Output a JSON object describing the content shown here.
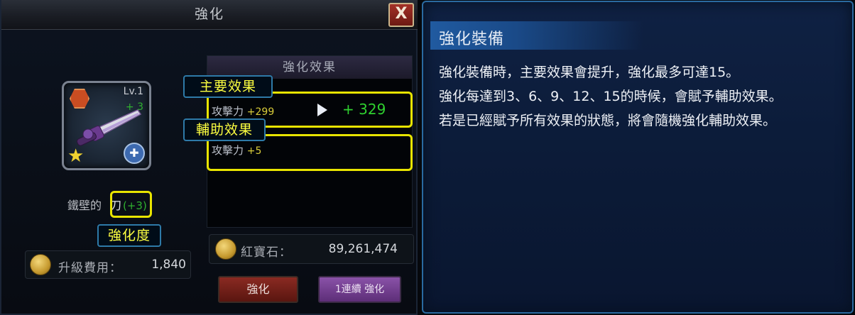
{
  "window": {
    "title": "強化",
    "close_label": "X"
  },
  "item": {
    "level": "Lv.1",
    "plus": "+ 3",
    "name": "鐵壁的",
    "name_suffix": "刀",
    "enhance_badge": "(+3)"
  },
  "tags": {
    "enhance_level": "強化度",
    "main_effect": "主要效果",
    "sub_effect": "輔助效果"
  },
  "cost": {
    "label": "升級費用：",
    "value": "1,840"
  },
  "effects": {
    "header": "強化效果",
    "main": {
      "stat": "攻擊力",
      "current": "+299",
      "next": "+ 329"
    },
    "sub": {
      "stat": "攻擊力",
      "value": "+5"
    }
  },
  "ruby": {
    "label": "紅寶石：",
    "value": "89,261,474"
  },
  "buttons": {
    "enhance": "強化",
    "continuous": "1連續 強化"
  },
  "info": {
    "title": "強化裝備",
    "lines": [
      "強化裝備時，主要效果會提升，強化最多可達15。",
      "強化每達到3、6、9、12、15的時候，會賦予輔助效果。",
      "若是已經賦予所有效果的狀態，將會隨機強化輔助效果。"
    ]
  },
  "colors": {
    "highlight": "#e8e400",
    "green_value": "#2fd12f",
    "panel_border": "#2a6aa0"
  }
}
